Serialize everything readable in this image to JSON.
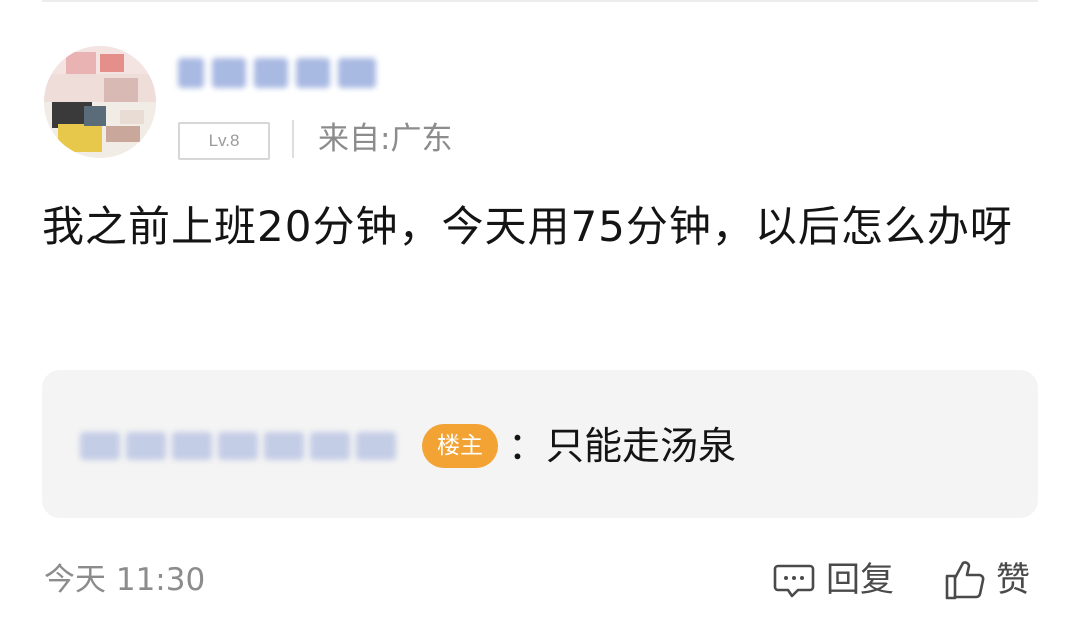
{
  "user": {
    "level": "Lv.8",
    "location": "来自:广东"
  },
  "comment": {
    "text": "我之前上班20分钟，今天用75分钟，以后怎么办呀"
  },
  "reply": {
    "host_badge": "楼主",
    "text": "：只能走汤泉"
  },
  "footer": {
    "timestamp": "今天 11:30",
    "reply_label": "回复",
    "like_label": "赞"
  },
  "colors": {
    "host_badge": "#f2a334",
    "reply_box_bg": "#f4f4f4",
    "meta_text": "#8c8c8c"
  },
  "icons": {
    "reply": "comment-bubble-icon",
    "like": "thumbs-up-icon"
  }
}
